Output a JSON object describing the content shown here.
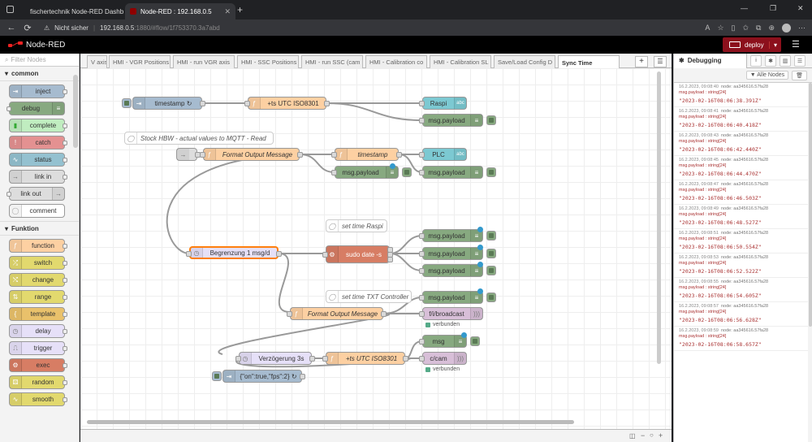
{
  "browser": {
    "tabs": [
      {
        "title": "fischertechnik Node-RED Dashb"
      },
      {
        "title": "Node-RED : 192.168.0.5"
      }
    ],
    "security_label": "Nicht sicher",
    "url_host": "192.168.0.5",
    "url_rest": ":1880/#flow/1f753370.3a7abd"
  },
  "app": {
    "title": "Node-RED",
    "deploy_label": "deploy"
  },
  "palette": {
    "filter_placeholder": "Filter Nodes",
    "categories": [
      {
        "label": "common",
        "nodes": [
          "inject",
          "debug",
          "complete",
          "catch",
          "status",
          "link in",
          "link out",
          "comment"
        ]
      },
      {
        "label": "Funktion",
        "nodes": [
          "function",
          "switch",
          "change",
          "range",
          "template",
          "delay",
          "trigger",
          "exec",
          "random",
          "smooth"
        ]
      }
    ]
  },
  "workspace": {
    "tabs": [
      "V axis",
      "HMI - VGR Positions",
      "HMI - run VGR axis",
      "HMI - SSC Positions",
      "HMI - run SSC (cam",
      "HMI - Calibration co",
      "HMI - Calibration SL",
      "Save/Load Config D",
      "Sync Time"
    ],
    "active_tab": "Sync Time"
  },
  "flow": {
    "nodes": {
      "n_ts_inject": "timestamp ↻",
      "n_ts_utc1": "+ts UTC ISO8301",
      "n_raspi": "Raspi",
      "n_mp1": "msg.payload",
      "c_stock": "Stock HBW - actual values to MQTT - Read",
      "n_fmt1": "Format Output Message",
      "n_timestamp": "timestamp",
      "n_plc": "PLC",
      "n_mp2": "msg.payload",
      "c_raspi": "set time Raspi",
      "n_begrenzung": "Begrenzung 1 msg/d",
      "n_sudo": "sudo date -s",
      "n_mp3": "msg.payload",
      "n_mp4": "msg.payload",
      "n_mp5": "msg.payload",
      "c_txt": "set time TXT Controller",
      "n_mp6": "msg.payload",
      "n_fmt2": "Format Output Message",
      "n_broadcast": "f/i/broadcast",
      "s_broadcast": "verbunden",
      "n_msg": "msg",
      "n_delay": "Verzögerung 3s",
      "n_ts_utc2": "+ts UTC ISO8301",
      "n_ccam": "c/cam",
      "s_ccam": "verbunden",
      "n_inject2": "{\"on\":true,\"fps\":2} ↻"
    }
  },
  "sidebar": {
    "title": "Debugging",
    "filter_label": "Alle Nodes",
    "messages": [
      {
        "meta": "16.2.2023, 09:08:40",
        "node": "node: aa345616.57fa28",
        "type": "msg.payload : string[24]",
        "value": "\"2023-02-16T08:06:38.391Z\""
      },
      {
        "meta": "16.2.2023, 09:08:41",
        "node": "node: aa345616.57fa28",
        "type": "msg.payload : string[24]",
        "value": "\"2023-02-16T08:06:40.418Z\""
      },
      {
        "meta": "16.2.2023, 09:08:43",
        "node": "node: aa345616.57fa28",
        "type": "msg.payload : string[24]",
        "value": "\"2023-02-16T08:06:42.440Z\""
      },
      {
        "meta": "16.2.2023, 09:08:45",
        "node": "node: aa345616.57fa28",
        "type": "msg.payload : string[24]",
        "value": "\"2023-02-16T08:06:44.470Z\""
      },
      {
        "meta": "16.2.2023, 09:08:47",
        "node": "node: aa345616.57fa28",
        "type": "msg.payload : string[24]",
        "value": "\"2023-02-16T08:06:46.503Z\""
      },
      {
        "meta": "16.2.2023, 09:08:49",
        "node": "node: aa345616.57fa28",
        "type": "msg.payload : string[24]",
        "value": "\"2023-02-16T08:06:48.527Z\""
      },
      {
        "meta": "16.2.2023, 09:08:51",
        "node": "node: aa345616.57fa28",
        "type": "msg.payload : string[24]",
        "value": "\"2023-02-16T08:06:50.554Z\""
      },
      {
        "meta": "16.2.2023, 09:08:53",
        "node": "node: aa345616.57fa28",
        "type": "msg.payload : string[24]",
        "value": "\"2023-02-16T08:06:52.522Z\""
      },
      {
        "meta": "16.2.2023, 09:08:55",
        "node": "node: aa345616.57fa28",
        "type": "msg.payload : string[24]",
        "value": "\"2023-02-16T08:06:54.605Z\""
      },
      {
        "meta": "16.2.2023, 09:08:57",
        "node": "node: aa345616.57fa28",
        "type": "msg.payload : string[24]",
        "value": "\"2023-02-16T08:06:56.628Z\""
      },
      {
        "meta": "16.2.2023, 09:08:59",
        "node": "node: aa345616.57fa28",
        "type": "msg.payload : string[24]",
        "value": "\"2023-02-16T08:06:58.657Z\""
      }
    ]
  },
  "colors": {
    "deploy": "#8c101c",
    "inject": "#a6bbcf",
    "function": "#fdd0a2",
    "debug": "#87a980",
    "ui": "#7cc9d2",
    "mqtt": "#d8bfd8",
    "exec": "#d77d64"
  }
}
